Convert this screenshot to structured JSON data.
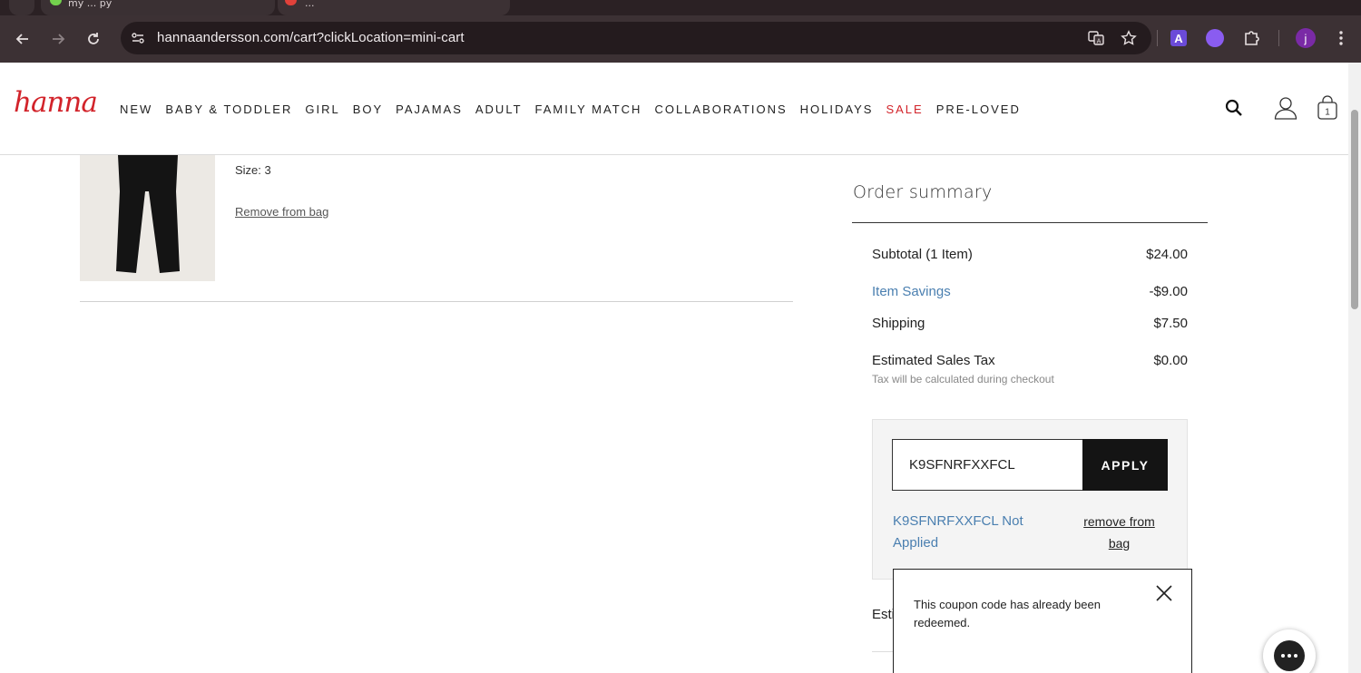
{
  "browser": {
    "tabs": [
      {
        "title": "my ... py"
      },
      {
        "title": "... "
      }
    ],
    "url": "hannaandersson.com/cart?clickLocation=mini-cart",
    "profile_initial": "j",
    "extension_a": "A"
  },
  "header": {
    "logo": "hanna",
    "nav": [
      "NEW",
      "BABY & TODDLER",
      "GIRL",
      "BOY",
      "PAJAMAS",
      "ADULT",
      "FAMILY MATCH",
      "COLLABORATIONS",
      "HOLIDAYS",
      "SALE",
      "PRE-LOVED"
    ],
    "bag_count": "1"
  },
  "cart_item": {
    "size": "Size: 3",
    "remove_label": "Remove from bag"
  },
  "order_summary": {
    "title": "Order summary",
    "subtotal_label": "Subtotal (1 Item)",
    "subtotal_value": "$24.00",
    "savings_label": "Item Savings",
    "savings_value": "-$9.00",
    "shipping_label": "Shipping",
    "shipping_value": "$7.50",
    "tax_label": "Estimated Sales Tax",
    "tax_value": "$0.00",
    "tax_note": "Tax will be calculated during checkout",
    "estimated_partial": "Esti"
  },
  "promo": {
    "code_value": "K9SFNRFXXFCL",
    "apply_label": "APPLY",
    "status": "K9SFNRFXXFCL Not Applied",
    "remove_label": "remove from bag"
  },
  "tooltip": {
    "message": "This coupon code has already been redeemed."
  },
  "colors": {
    "brand_red": "#d2232a",
    "link_blue": "#4a7fb0",
    "chrome_dark": "#3c3134"
  }
}
